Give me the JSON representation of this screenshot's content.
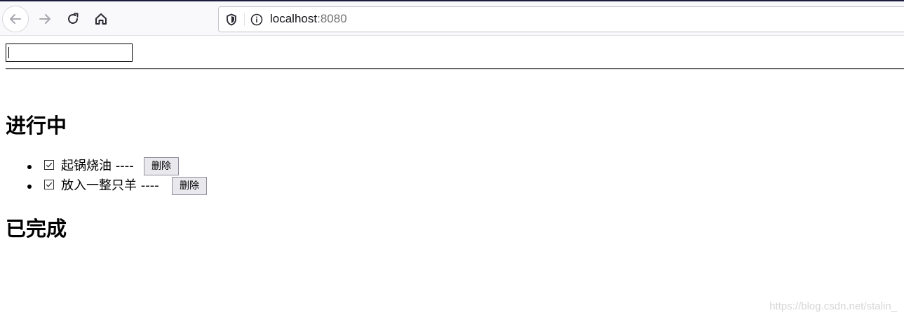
{
  "browser": {
    "url_host": "localhost",
    "url_port": ":8080"
  },
  "icons": {
    "back": "arrow-left-icon",
    "forward": "arrow-right-icon",
    "reload": "reload-icon",
    "home": "home-icon",
    "shield": "shield-icon",
    "info": "info-icon"
  },
  "page": {
    "input_value": "",
    "ongoing_heading": "进行中",
    "done_heading": "已完成",
    "ongoing_items": [
      {
        "text": "起锅烧油 ----",
        "checked": true,
        "delete_label": "删除"
      },
      {
        "text": "放入一整只羊 ----",
        "checked": true,
        "delete_label": "删除"
      }
    ],
    "done_items": []
  },
  "watermark": "https://blog.csdn.net/stalin_"
}
